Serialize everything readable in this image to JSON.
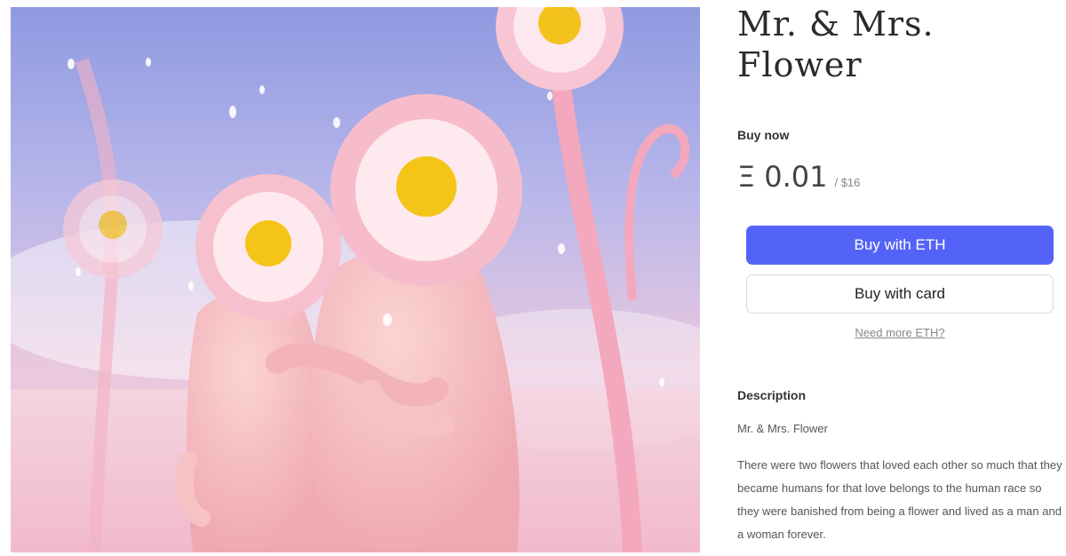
{
  "artwork": {
    "alt": "Mr. & Mrs. Flower artwork"
  },
  "item": {
    "title": "Mr. & Mrs. Flower"
  },
  "purchase": {
    "buy_now_label": "Buy now",
    "currency_symbol": "Ξ",
    "price_eth": "0.01",
    "price_usd": "/ $16",
    "buy_eth_label": "Buy with ETH",
    "buy_card_label": "Buy with card",
    "need_more_eth_label": "Need more ETH?"
  },
  "description": {
    "heading": "Description",
    "name": "Mr. & Mrs. Flower",
    "body": "There were two flowers that loved each other so much that they became humans for that love belongs to the human race so they were banished from being a flower and lived as a man and a woman forever."
  },
  "colors": {
    "primary_button": "#5463f7",
    "card_button_border": "#d8d8d8",
    "link_gray": "#888888"
  }
}
